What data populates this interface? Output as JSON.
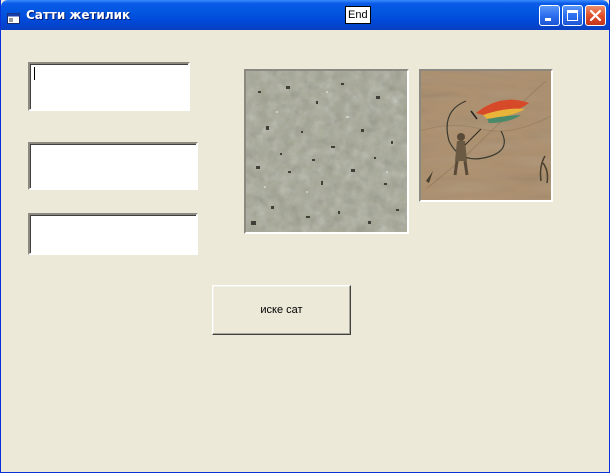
{
  "window": {
    "title": "Сатти жетилик",
    "end_badge": "End"
  },
  "controls": {
    "textbox1_value": "",
    "textbox2_value": "",
    "textbox3_value": ""
  },
  "images": {
    "picture1": "stone-texture-image",
    "picture2": "fishing-fly-image"
  },
  "button": {
    "start_label": "иске сат"
  },
  "colors": {
    "titlebar": "#0256df",
    "window_bg": "#ece9d8",
    "close_button": "#e0502a"
  }
}
